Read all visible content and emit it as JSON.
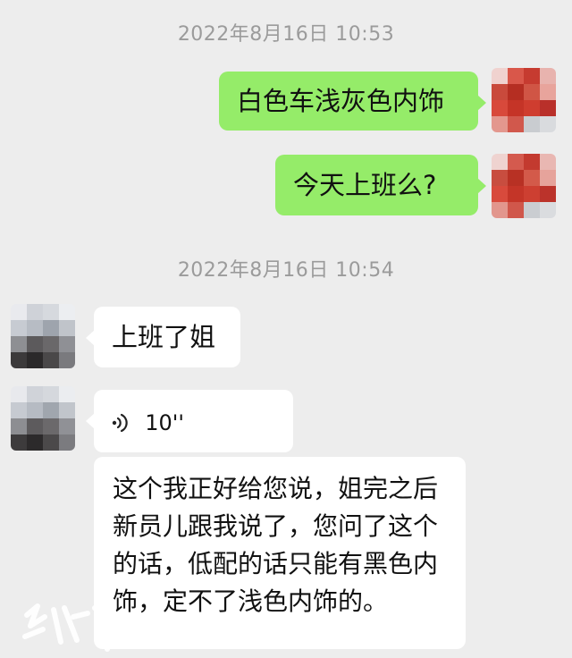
{
  "timestamps": [
    "2022年8月16日 10:53",
    "2022年8月16日 10:54"
  ],
  "messages": {
    "m1": "白色车浅灰色内饰",
    "m2": "今天上班么?",
    "m3": "上班了姐",
    "m4_voice_duration": "10''",
    "m5": "这个我正好给您说，姐完之后新员儿跟我说了，您问了这个的话，低配的话只能有黑色内饰，定不了浅色内饰的。"
  },
  "colors": {
    "background": "#ededed",
    "sent_bubble": "#95ec69",
    "received_bubble": "#ffffff",
    "timestamp_text": "#9b9b9b"
  },
  "icons": {
    "voice": "voice-wave-icon",
    "watermark": "calligraphy-watermark"
  }
}
